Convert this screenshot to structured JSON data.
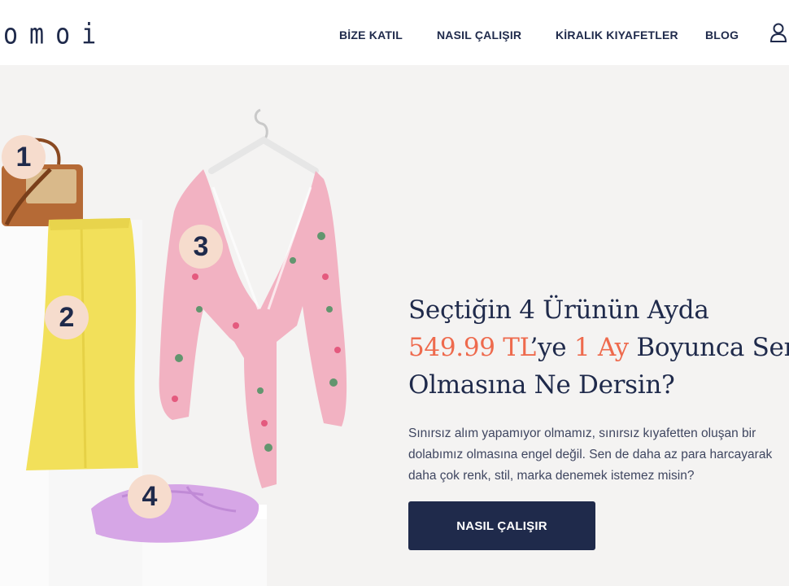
{
  "header": {
    "logo": "omoi",
    "nav": [
      {
        "label": "BİZE KATIL"
      },
      {
        "label": "NASIL ÇALIŞIR"
      },
      {
        "label": "KİRALIK KIYAFETLER"
      },
      {
        "label": "BLOG"
      }
    ],
    "user_icon": "user-icon"
  },
  "hero": {
    "badges": [
      "1",
      "2",
      "3",
      "4"
    ],
    "headline": {
      "line1": "Seçtiğin 4 Ürünün Ayda",
      "price": "549.99 TL",
      "mid": "’ye ",
      "duration": "1 Ay",
      "rest": " Boyunca Senin",
      "line3": "Olmasına Ne Dersin?"
    },
    "description": [
      "Sınırsız alım yapamıyor olmamız, sınırsız kıyafetten oluşan bir",
      "dolabımız olmasına engel değil. Sen de daha az para harcayarak",
      "daha çok renk, stil, marka denemek istemez misin?"
    ],
    "cta_label": "NASIL ÇALIŞIR",
    "colors": {
      "navy": "#1f2a4b",
      "accent": "#ee6a4d",
      "badge": "#f6dccd"
    }
  }
}
